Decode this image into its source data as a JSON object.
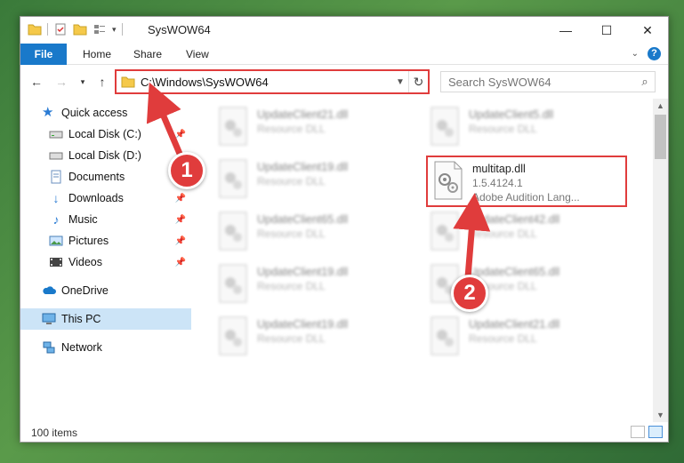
{
  "window": {
    "title": "SysWOW64",
    "controls": {
      "minimize": "—",
      "maximize": "☐",
      "close": "✕"
    }
  },
  "ribbon": {
    "tabs": [
      "File",
      "Home",
      "Share",
      "View"
    ],
    "help": "?"
  },
  "navigation": {
    "address_path": "C:\\Windows\\SysWOW64",
    "search_placeholder": "Search SysWOW64"
  },
  "sidebar": {
    "items": [
      {
        "label": "Quick access",
        "icon": "star-icon"
      },
      {
        "label": "Local Disk (C:)",
        "icon": "drive-icon",
        "pinned": true
      },
      {
        "label": "Local Disk (D:)",
        "icon": "drive-icon"
      },
      {
        "label": "Documents",
        "icon": "documents-icon",
        "pinned": true
      },
      {
        "label": "Downloads",
        "icon": "downloads-icon",
        "pinned": true
      },
      {
        "label": "Music",
        "icon": "music-icon",
        "pinned": true
      },
      {
        "label": "Pictures",
        "icon": "pictures-icon",
        "pinned": true
      },
      {
        "label": "Videos",
        "icon": "videos-icon",
        "pinned": true
      },
      {
        "label": "OneDrive",
        "icon": "cloud-icon"
      },
      {
        "label": "This PC",
        "icon": "pc-icon",
        "selected": true
      },
      {
        "label": "Network",
        "icon": "network-icon"
      }
    ]
  },
  "files": {
    "left_column": [
      {
        "name": "UpdateClient21.dll",
        "type": "Resource DLL"
      },
      {
        "name": "UpdateClient19.dll",
        "type": "Resource DLL"
      },
      {
        "name": "UpdateClient65.dll",
        "type": "Resource DLL"
      },
      {
        "name": "UpdateClient19.dll",
        "type": "Resource DLL"
      },
      {
        "name": "UpdateClient19.dll",
        "type": "Resource DLL"
      }
    ],
    "right_column": [
      {
        "name": "UpdateClient5.dll",
        "type": "Resource DLL"
      },
      {
        "name": "multitap.dll",
        "version": "1.5.4124.1",
        "type": "Adobe Audition Lang...",
        "highlighted": true
      },
      {
        "name": "UpdateClient42.dll",
        "type": "Resource DLL"
      },
      {
        "name": "UpdateClient65.dll",
        "type": "Resource DLL"
      },
      {
        "name": "UpdateClient21.dll",
        "type": "Resource DLL"
      }
    ]
  },
  "status": {
    "item_count": "100 items"
  },
  "annotations": {
    "step1": "1",
    "step2": "2"
  },
  "colors": {
    "accent": "#1979ca",
    "highlight": "#e03c3c",
    "selected": "#cce4f7"
  }
}
